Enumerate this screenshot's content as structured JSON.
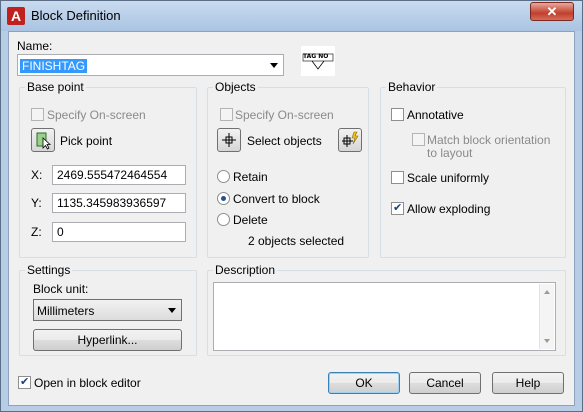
{
  "window": {
    "title": "Block Definition",
    "close_glyph": "✕"
  },
  "name": {
    "label": "Name:",
    "value": "FINISHTAG",
    "preview_text": "TAG NO"
  },
  "base_point": {
    "title": "Base point",
    "specify_onscreen": "Specify On-screen",
    "pick_point": "Pick point",
    "x_label": "X:",
    "x_value": "2469.555472464554",
    "y_label": "Y:",
    "y_value": "1135.345983936597",
    "z_label": "Z:",
    "z_value": "0"
  },
  "objects": {
    "title": "Objects",
    "specify_onscreen": "Specify On-screen",
    "select_objects": "Select objects",
    "retain": "Retain",
    "convert_to_block": "Convert to block",
    "delete": "Delete",
    "selected_status": "2 objects selected",
    "selected_option": "Convert to block"
  },
  "behavior": {
    "title": "Behavior",
    "annotative": "Annotative",
    "match_orientation_line1": "Match block orientation",
    "match_orientation_line2": "to layout",
    "scale_uniformly": "Scale uniformly",
    "allow_exploding": "Allow exploding",
    "allow_exploding_checked": true
  },
  "settings": {
    "title": "Settings",
    "block_unit_label": "Block unit:",
    "block_unit_value": "Millimeters",
    "hyperlink_button": "Hyperlink..."
  },
  "description": {
    "title": "Description",
    "value": ""
  },
  "footer": {
    "open_in_editor": "Open in block editor",
    "open_in_editor_checked": true,
    "ok": "OK",
    "cancel": "Cancel",
    "help": "Help"
  },
  "icons": {
    "app": "autocad-icon",
    "pick_point": "pick-point-icon",
    "select_objects": "select-objects-icon",
    "quick_select": "quick-select-icon",
    "scroll_up": "scroll-up-arrow",
    "scroll_down": "scroll-down-arrow"
  },
  "colors": {
    "title_bar": "#b7cde6",
    "close_button": "#c0402c",
    "selection": "#3399ff"
  }
}
